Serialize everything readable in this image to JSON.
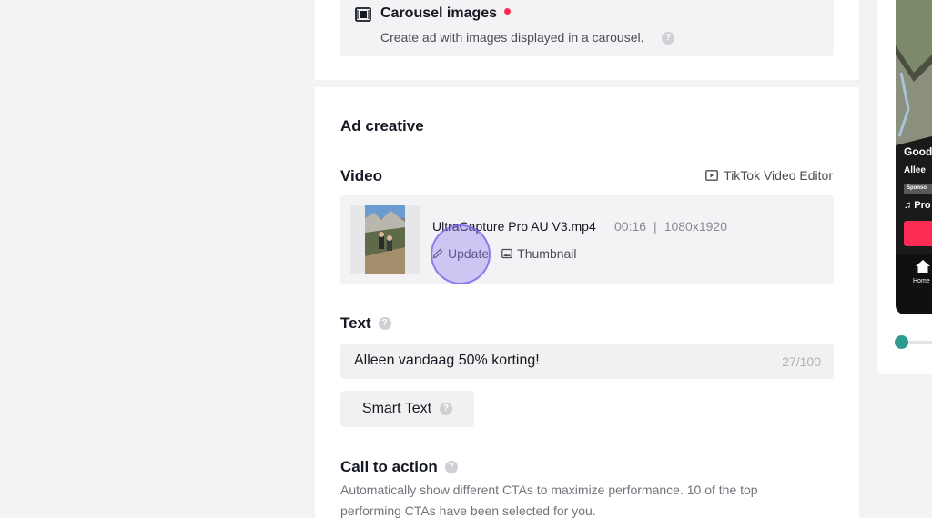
{
  "ad_format": {
    "carousel_title": "Carousel images",
    "carousel_description": "Create ad with images displayed in a carousel."
  },
  "ad_creative": {
    "section_title": "Ad creative",
    "video": {
      "label": "Video",
      "editor_link": "TikTok Video Editor",
      "file_name": "UltraCapture Pro AU V3.mp4",
      "duration": "00:16",
      "separator": "|",
      "resolution": "1080x1920",
      "update_label": "Update",
      "thumbnail_label": "Thumbnail"
    },
    "text": {
      "label": "Text",
      "value": "Alleen vandaag 50% korting!",
      "count": "27/100"
    },
    "smart_text_label": "Smart Text",
    "call_to_action": {
      "label": "Call to action",
      "description": "Automatically show different CTAs to maximize performance. 10 of the top performing CTAs have been selected for you."
    }
  },
  "preview": {
    "title_fragment": "Good",
    "account_fragment": "Allee",
    "sponsored_fragment": "Sponso",
    "music_fragment": "♫ Pro",
    "home_label": "Home"
  },
  "colors": {
    "accent_red": "#fe2c55",
    "slider_teal": "#2f9b8e",
    "click_highlight": "#8773f0"
  }
}
